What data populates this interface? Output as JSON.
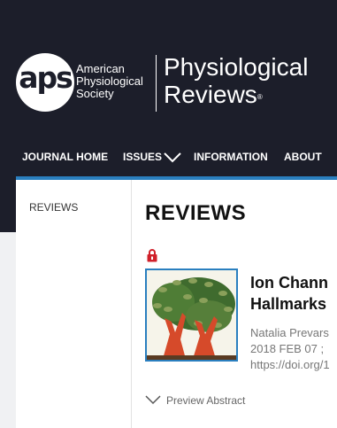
{
  "header": {
    "logo_text": "aps",
    "logo_reg": "®",
    "society_lines": [
      "American",
      "Physiological",
      "Society"
    ],
    "journal_lines": [
      "Physiological",
      "Reviews"
    ],
    "journal_reg": "®"
  },
  "nav": {
    "items": [
      "JOURNAL HOME",
      "ISSUES",
      "INFORMATION",
      "ABOUT"
    ]
  },
  "sidebar": {
    "items": [
      "REVIEWS"
    ]
  },
  "main": {
    "page_title": "REVIEWS",
    "article": {
      "title_lines": [
        "Ion Chann",
        "Hallmarks"
      ],
      "meta_lines": [
        "Natalia Prevars",
        "2018 FEB 07 ;",
        "https://doi.org/1"
      ],
      "access_icon": "lock-icon",
      "preview_label": "Preview Abstract"
    }
  },
  "colors": {
    "header_bg": "#1c1e2a",
    "accent": "#2a7fbf",
    "lock": "#d0202a"
  }
}
